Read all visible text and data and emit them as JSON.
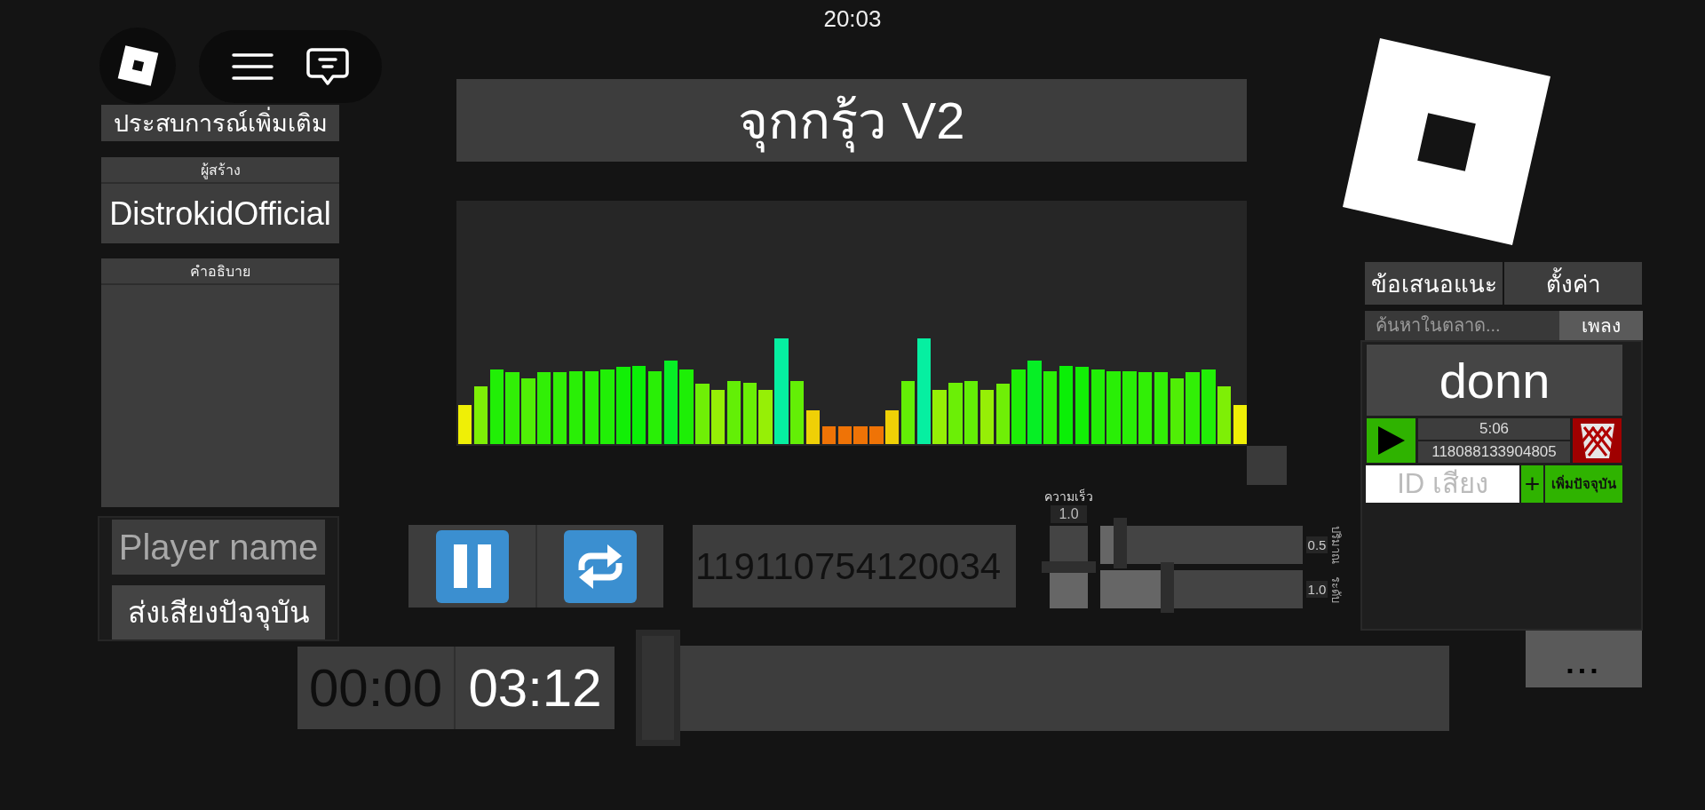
{
  "status_bar": {
    "time": "20:03"
  },
  "left_panel": {
    "experience_button": "ประสบการณ์เพิ่มเติม",
    "creator": {
      "heading": "ผู้สร้าง",
      "name": "DistrokidOfficial"
    },
    "description": {
      "heading": "คำอธิบาย"
    },
    "player_field": {
      "placeholder": "Player name"
    },
    "send_button": "ส่งเสียงปัจจุบัน"
  },
  "player": {
    "title": "จุกกรุ้ว V2",
    "playing": true,
    "sound_id": "119110754120034"
  },
  "speed": {
    "label": "ความเร็ว",
    "reading": "1.0",
    "level": 0.5
  },
  "sliders": [
    {
      "label": "ปริมาณ",
      "reading": "0.5",
      "level": 0.1
    },
    {
      "label": "ระดับ",
      "reading": "1.0",
      "level": 0.33
    }
  ],
  "time": {
    "elapsed": "00:00",
    "total": "03:12"
  },
  "progress": {
    "level": 0
  },
  "right_panel": {
    "tabs": [
      {
        "label": "ข้อเสนอแนะ"
      },
      {
        "label": "ตั้งค่า"
      }
    ],
    "search": {
      "placeholder": "ค้นหาในตลาด...",
      "button": "เพลง"
    },
    "results": [
      {
        "title": "donn",
        "duration": "5:06",
        "sound_id": "118088133904805"
      }
    ],
    "id_field": {
      "placeholder": "ID เสียง"
    },
    "add_button": "+",
    "add_current_button": "เพิ่มปัจจุบัน"
  },
  "more_button": "..."
}
